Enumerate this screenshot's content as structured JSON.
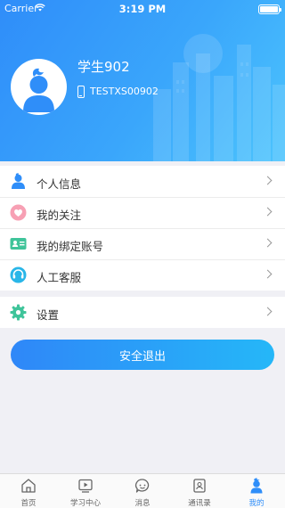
{
  "status_bar": {
    "carrier": "Carrier",
    "time": "3:19 PM"
  },
  "profile": {
    "name": "学生902",
    "account_id": "TESTXS00902"
  },
  "menu": {
    "items": [
      {
        "label": "个人信息",
        "icon": "person-icon"
      },
      {
        "label": "我的关注",
        "icon": "heart-icon"
      },
      {
        "label": "我的绑定账号",
        "icon": "id-card-icon"
      },
      {
        "label": "人工客服",
        "icon": "headset-icon"
      }
    ]
  },
  "settings": {
    "label": "设置",
    "icon": "gear-icon"
  },
  "logout": {
    "label": "安全退出"
  },
  "tabbar": {
    "tabs": [
      {
        "label": "首页",
        "icon": "home-icon"
      },
      {
        "label": "学习中心",
        "icon": "video-icon"
      },
      {
        "label": "消息",
        "icon": "chat-icon"
      },
      {
        "label": "通讯录",
        "icon": "contacts-icon"
      },
      {
        "label": "我的",
        "icon": "profile-icon",
        "active": true
      }
    ]
  },
  "colors": {
    "primary": "#2f8ef9",
    "accent": "#25b7f8",
    "background": "#f0f0f5"
  }
}
